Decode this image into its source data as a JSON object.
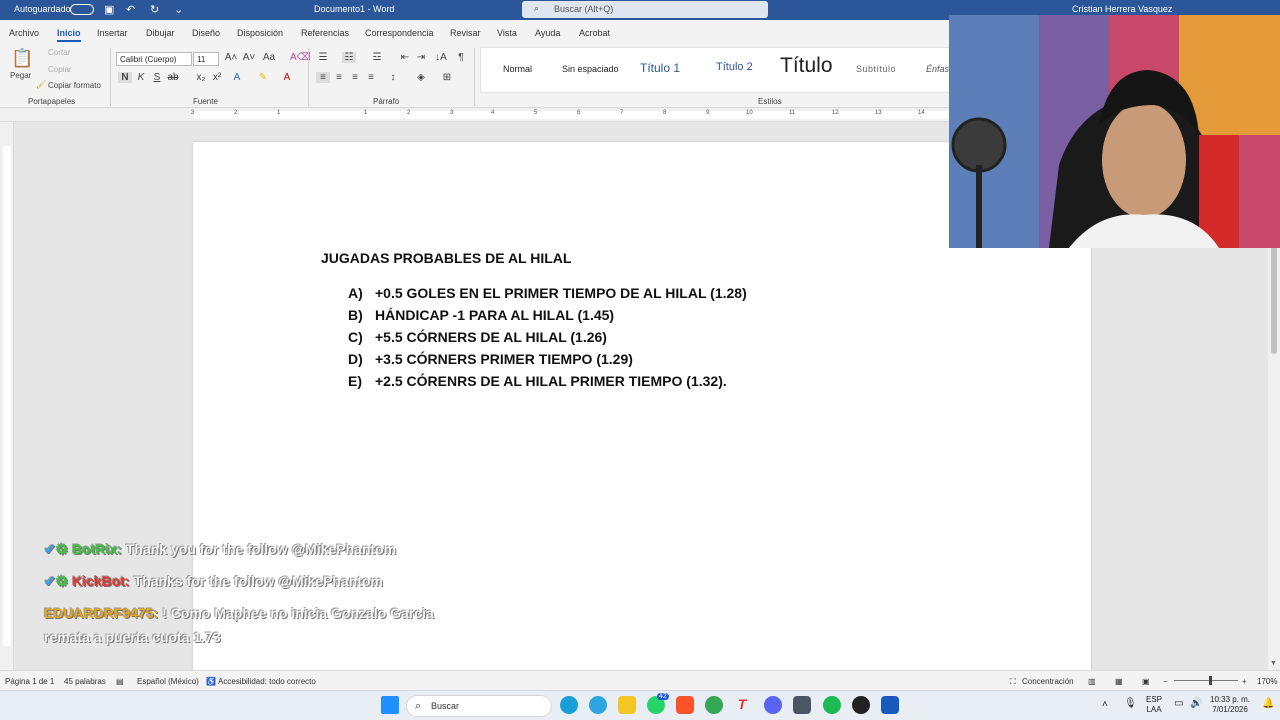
{
  "titlebar": {
    "autosave": "Autoguardado",
    "doc_title": "Documento1 - Word",
    "search": "Buscar (Alt+Q)",
    "user": "Cristian Herrera Vasquez"
  },
  "tabs": [
    "Archivo",
    "Inicio",
    "Insertar",
    "Dibujar",
    "Diseño",
    "Disposición",
    "Referencias",
    "Correspondencia",
    "Revisar",
    "Vista",
    "Ayuda",
    "Acrobat"
  ],
  "ribbon": {
    "paste": "Pegar",
    "cut": "Cortar",
    "copy": "Copiar",
    "format_painter": "Copiar formato",
    "font_name": "Calibri (Cuerpo)",
    "font_size": "11",
    "groups": {
      "clipboard": "Portapapeles",
      "font": "Fuente",
      "paragraph": "Párrafo",
      "styles": "Estilos"
    },
    "styles": [
      "Normal",
      "Sin espaciado",
      "Título 1",
      "Título 2",
      "Título",
      "Subtítulo",
      "Énfasis"
    ]
  },
  "ruler_numbers": [
    "3",
    "2",
    "1",
    "1",
    "2",
    "3",
    "4",
    "5",
    "6",
    "7",
    "8",
    "9",
    "10",
    "11",
    "12",
    "13",
    "14"
  ],
  "document": {
    "heading": "JUGADAS PROBABLES DE AL HILAL",
    "items": [
      {
        "label": "A)",
        "text": "+0.5 GOLES EN EL PRIMER TIEMPO DE AL HILAL (1.28)"
      },
      {
        "label": "B)",
        "text": "HÁNDICAP -1 PARA AL HILAL (1.45)"
      },
      {
        "label": "C)",
        "text": "+5.5 CÓRNERS DE AL HILAL (1.26)"
      },
      {
        "label": "D)",
        "text": "+3.5 CÓRNERS PRIMER TIEMPO (1.29)"
      },
      {
        "label": "E)",
        "text": "+2.5 CÓRENRS DE AL HILAL PRIMER TIEMPO (1.32)."
      }
    ]
  },
  "chat": [
    {
      "user": "BotRix:",
      "message": "Thank you for the follow @MikePhantom"
    },
    {
      "user": "KickBot:",
      "message": "Thanks for the follow @MikePhantom"
    },
    {
      "user": "EDUARDRF9475:",
      "message": "! Como Maphee no inicia Gonzalo Garcia",
      "message2": "remata a puerta cuota 1.73"
    }
  ],
  "statusbar": {
    "page": "Página 1 de 1",
    "words": "45 palabras",
    "language": "Español (México)",
    "accessibility": "Accesibilidad: todo correcto",
    "focus": "Concentración",
    "zoom": "170%"
  },
  "taskbar": {
    "search": "Buscar",
    "lang": "ESP",
    "lang2": "LAA",
    "time": "10:33 p. m.",
    "date": "7/01/2026",
    "whatsapp_badge": "42"
  },
  "colors": {
    "word_blue": "#2b579a",
    "accent": "#185abd"
  }
}
